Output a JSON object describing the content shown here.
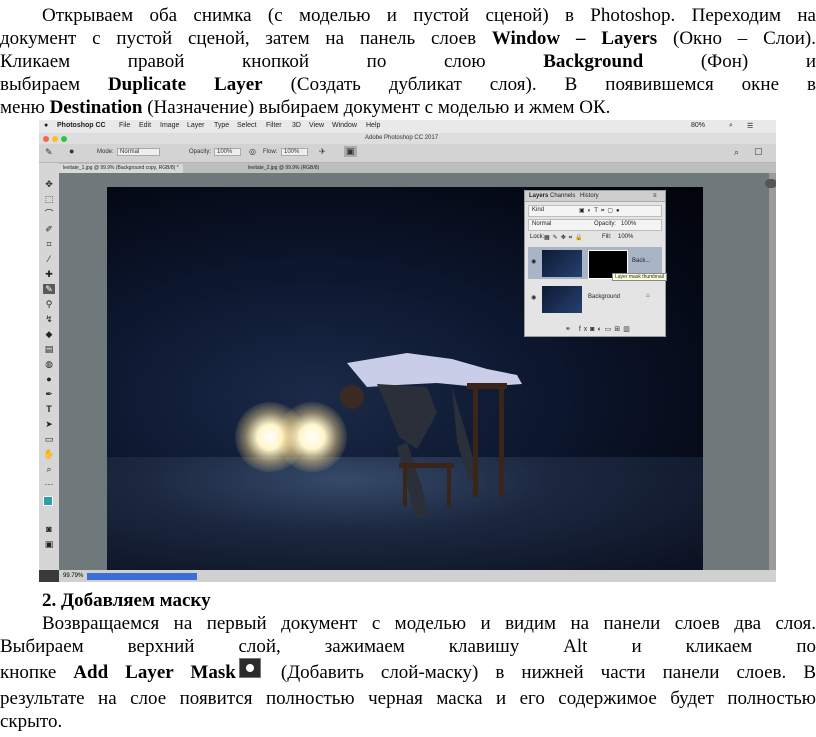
{
  "intro": {
    "line1": "Открываем оба снимка (с моделью и пустой сценой) в Photoshop. Переходим на",
    "line2_a": "документ с пустой сценой, затем на панель слоев ",
    "line2_b": "Window – Layers",
    "line2_c": " (Окно – Слои).",
    "line3_a": "Кликаем правой кнопкой по слою ",
    "line3_b": "Background",
    "line3_c": " (Фон) и",
    "line4_a": "выбираем ",
    "line4_b": "Duplicate Layer",
    "line4_c": " (Создать дубликат слоя). В появившемся окне в",
    "line5_a": "меню ",
    "line5_b": "Destination",
    "line5_c": " (Назначение) выбираем документ с моделью и жмем ОК."
  },
  "screenshot": {
    "menu": {
      "apple": "",
      "app": "Photoshop CC",
      "items": [
        "File",
        "Edit",
        "Image",
        "Layer",
        "Type",
        "Select",
        "Filter",
        "3D",
        "View",
        "Window",
        "Help"
      ],
      "battery": "80%"
    },
    "window_title": "Adobe Photoshop CC 2017",
    "options": {
      "mode_label": "Mode:",
      "mode_value": "Normal",
      "opacity_label": "Opacity:",
      "opacity_value": "100%",
      "flow_label": "Flow:",
      "flow_value": "100%"
    },
    "tabs": [
      "levitate_1.jpg @ 99.9% (Background copy, RGB/8) *",
      "levitate_2.jpg @ 99.9% (RGB/8)"
    ],
    "status_zoom": "99.79%",
    "layers_panel": {
      "tabs": [
        "Layers",
        "Channels",
        "History"
      ],
      "kind": "Kind",
      "blend": "Normal",
      "opacity_label": "Opacity:",
      "opacity_value": "100%",
      "lock_label": "Lock:",
      "fill_label": "Fill:",
      "fill_value": "100%",
      "layer_top": "Back...",
      "tooltip": "Layer mask thumbnail",
      "layer_bottom": "Background",
      "footer": "fx"
    }
  },
  "section2": {
    "heading": "2. Добавляем маску",
    "p_line1": "Возвращаемся на первый документ с моделью и видим на панели слоев два слоя.",
    "p_line2": "Выбираем верхний слой, зажимаем клавишу Alt и кликаем по",
    "p_line3_a": "кнопке ",
    "p_line3_b": "Add Layer Mask",
    "p_line3_c": " (Добавить слой-маску) в нижней части панели слоев. В",
    "p_line4": "результате на слое появится полностью черная маска и его содержимое будет полностью",
    "p_line5": "скрыто."
  }
}
